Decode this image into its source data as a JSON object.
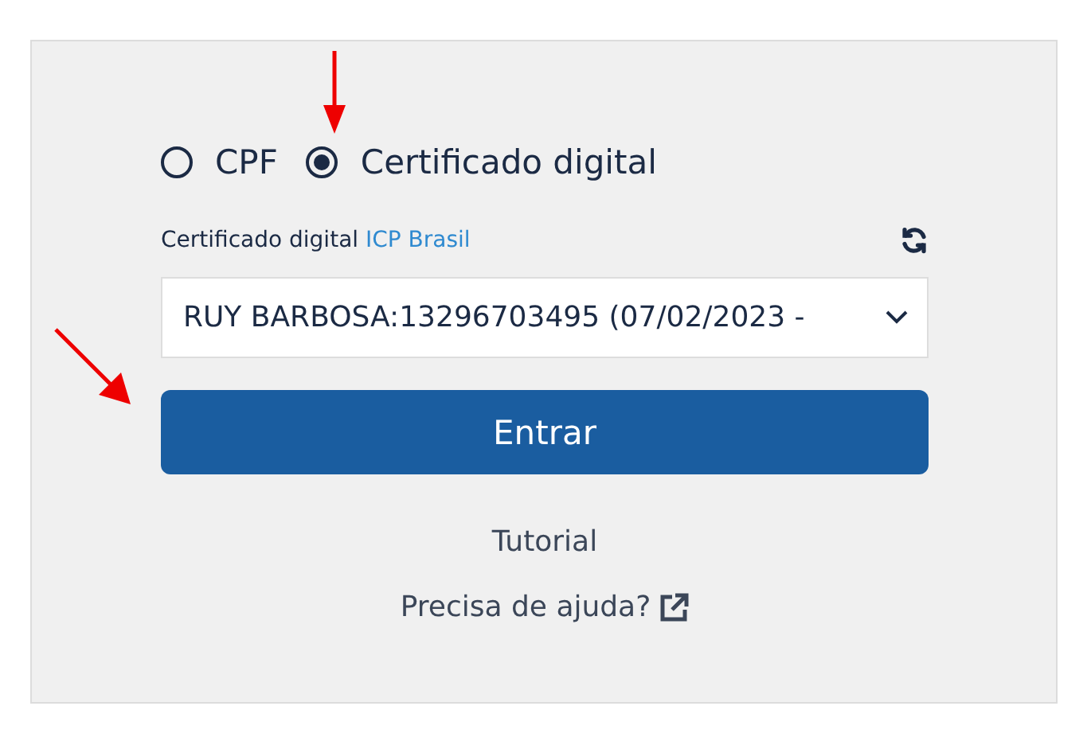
{
  "login_options": [
    {
      "label": "CPF",
      "selected": false
    },
    {
      "label": "Certificado digital",
      "selected": true
    }
  ],
  "certificate_label": {
    "text": "Certificado digital",
    "link": "ICP Brasil"
  },
  "certificate_select": {
    "value": "RUY BARBOSA:13296703495 (07/02/2023 -"
  },
  "submit_button": "Entrar",
  "links": [
    {
      "label": "Tutorial",
      "external": false
    },
    {
      "label": "Precisa de ajuda?",
      "external": true
    }
  ]
}
